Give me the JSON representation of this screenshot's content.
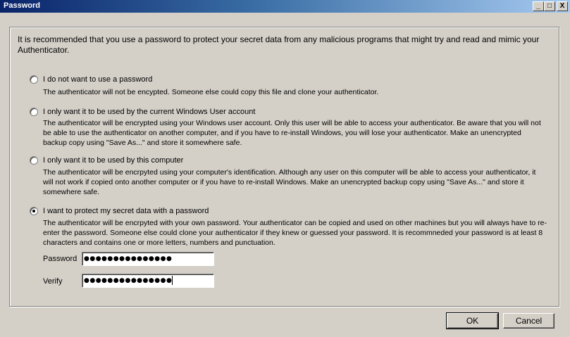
{
  "window": {
    "title": "Password",
    "controls": {
      "minimize": "_",
      "maximize": "□",
      "close": "X"
    }
  },
  "intro": "It is recommended that you use a password to protect your secret data from any malicious programs that might try and read and mimic your Authenticator.",
  "options": [
    {
      "label": "I do not want to use a password",
      "description": "The authenticator will not be encypted. Someone else could copy this file and clone your authenticator.",
      "selected": false
    },
    {
      "label": "I only want it to be used by the current Windows User account",
      "description": "The authenticator will be encrypted using your Windows user account. Only this user will be able to access your authenticator. Be aware that you will not be able to use the authenticator on another computer, and if you have to re-install Windows, you will lose your authenticator. Make an unencrypted backup copy using \"Save As...\" and store it somewhere safe.",
      "selected": false
    },
    {
      "label": "I only want it to be used by this computer",
      "description": "The authenticator will be encrpyted using your computer's identification. Although any user on this computer will be able to access your authenticator, it will not work if copied onto another computer or if you have to re-install Windows. Make an unencrypted backup copy using \"Save As...\" and store it somewhere safe.",
      "selected": false
    },
    {
      "label": "I want to protect my secret data with a password",
      "description": "The authenticator will be encrpyted with your own password. Your authenticator can be copied and used on other machines but you will always have to re-enter the password. Someone else could clone your authenticator if they knew or guessed your password. It is recommneded your password is at least 8 characters and contains one or more letters, numbers and punctuation.",
      "selected": true
    }
  ],
  "password": {
    "label": "Password",
    "value": "●●●●●●●●●●●●●●●"
  },
  "verify": {
    "label": "Verify",
    "value": "●●●●●●●●●●●●●●●"
  },
  "buttons": {
    "ok": "OK",
    "cancel": "Cancel"
  }
}
